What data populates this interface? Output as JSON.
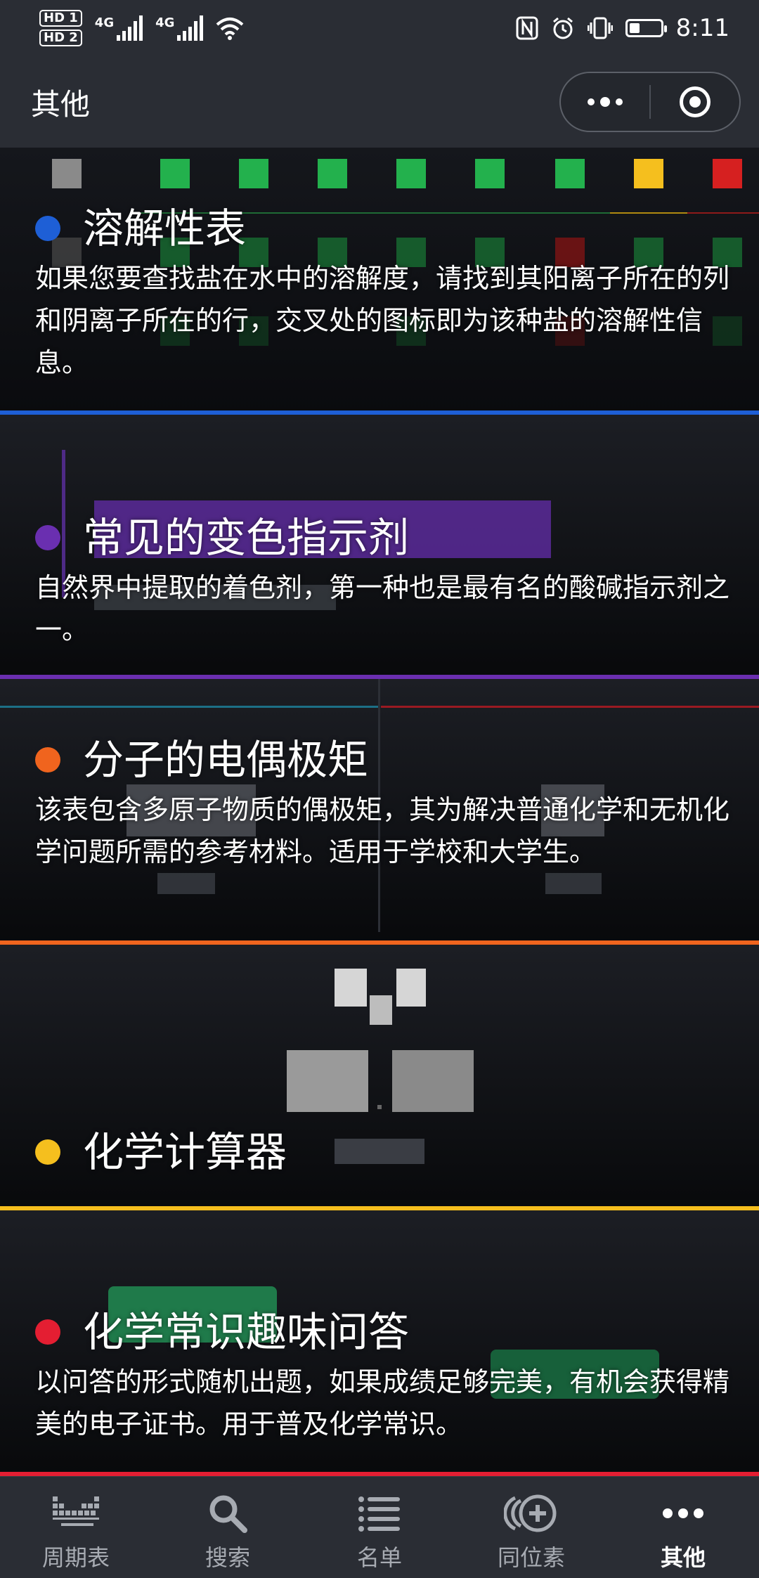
{
  "status_bar": {
    "hd1": "HD 1",
    "hd2": "HD 2",
    "net1": "4G",
    "net2": "4G",
    "time": "8:11",
    "battery_level_percent": 35
  },
  "header": {
    "title": "其他"
  },
  "cards": [
    {
      "title": "溶解性表",
      "description": "如果您要查找盐在水中的溶解度，请找到其阳离子所在的列和阴离子所在的行，交叉处的图标即为该种盐的溶解性信息。",
      "accent_color": "#1e5fd6"
    },
    {
      "title": "常见的变色指示剂",
      "description": "自然界中提取的着色剂，第一种也是最有名的酸碱指示剂之一。",
      "accent_color": "#6a2fb0"
    },
    {
      "title": "分子的电偶极矩",
      "description": "该表包含多原子物质的偶极矩，其为解决普通化学和无机化学问题所需的参考材料。适用于学校和大学生。",
      "accent_color": "#f0641e"
    },
    {
      "title": "化学计算器",
      "description": "",
      "accent_color": "#f5bf1e"
    },
    {
      "title": "化学常识趣味问答",
      "description": "以问答的形式随机出题，如果成绩足够完美，有机会获得精美的电子证书。用于普及化学常识。",
      "accent_color": "#e41e32"
    }
  ],
  "tabs": [
    {
      "label": "周期表",
      "icon": "periodic-table-icon",
      "active": false
    },
    {
      "label": "搜索",
      "icon": "search-icon",
      "active": false
    },
    {
      "label": "名单",
      "icon": "list-icon",
      "active": false
    },
    {
      "label": "同位素",
      "icon": "isotope-icon",
      "active": false
    },
    {
      "label": "其他",
      "icon": "more-icon",
      "active": true
    }
  ]
}
